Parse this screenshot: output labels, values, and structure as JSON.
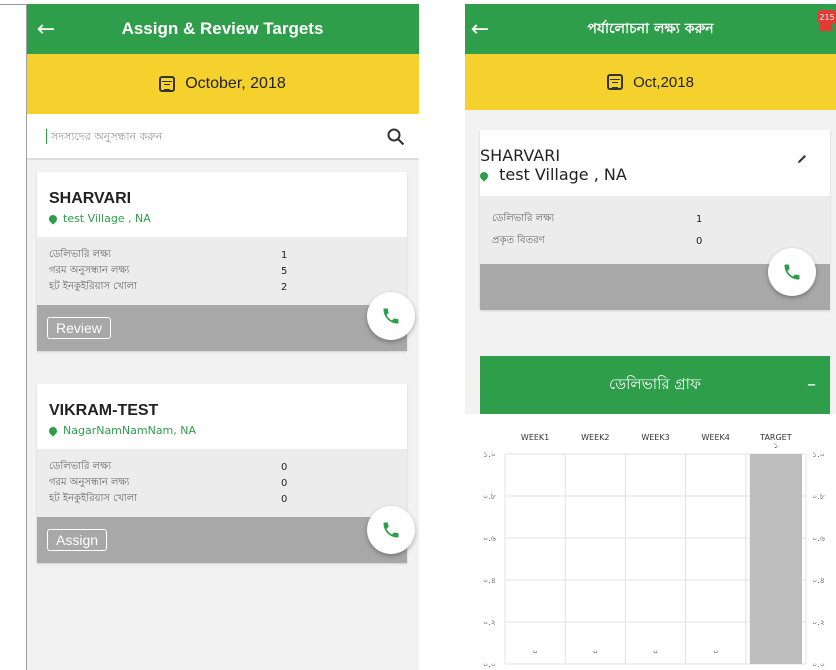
{
  "left": {
    "title": "Assign & Review Targets",
    "date": "October, 2018",
    "search_placeholder": "সদস্যদের অনুসন্ধান করুন",
    "cards": [
      {
        "name": "SHARVARI",
        "location": "test Village , NA",
        "stats": [
          {
            "label": "ডেলিভারি লক্ষ্য",
            "value": "1"
          },
          {
            "label": "গরম অনুসন্ধান লক্ষ্য",
            "value": "5"
          },
          {
            "label": "হট ইনকুইরিয়াস খোলা",
            "value": "2"
          }
        ],
        "action": "Review"
      },
      {
        "name": "VIKRAM-TEST",
        "location": "NagarNamNamNam, NA",
        "stats": [
          {
            "label": "ডেলিভারি লক্ষ্য",
            "value": "0"
          },
          {
            "label": "গরম অনুসন্ধান লক্ষ্য",
            "value": "0"
          },
          {
            "label": "হট ইনকুইরিয়াস খোলা",
            "value": "0"
          }
        ],
        "action": "Assign"
      }
    ]
  },
  "right": {
    "title": "পর্যালোচনা লক্ষ্য করুন",
    "badge": "215",
    "date": "Oct,2018",
    "card": {
      "name": "SHARVARI",
      "location": "test Village , NA",
      "stats": [
        {
          "label": "ডেলিভারি লক্ষ্য",
          "value": "1"
        },
        {
          "label": "প্রকৃত বিতরণ",
          "value": "0"
        }
      ]
    },
    "graph_title": "ডেলিভারি গ্রাফ",
    "graph_toggle": "–"
  },
  "colors": {
    "green": "#2e9e4b",
    "yellow": "#f4d12c",
    "grey": "#a8a8a8"
  },
  "chart_data": {
    "type": "bar",
    "categories": [
      "WEEK1",
      "WEEK2",
      "WEEK3",
      "WEEK4",
      "TARGET"
    ],
    "values": [
      0,
      0,
      0,
      0,
      1
    ],
    "value_labels": [
      "০",
      "০",
      "০",
      "০",
      "১"
    ],
    "y_ticks": [
      "০.০",
      "০.২",
      "০.৪",
      "০.৬",
      "০.৮",
      "১.০"
    ],
    "ylim": [
      0,
      1
    ]
  }
}
